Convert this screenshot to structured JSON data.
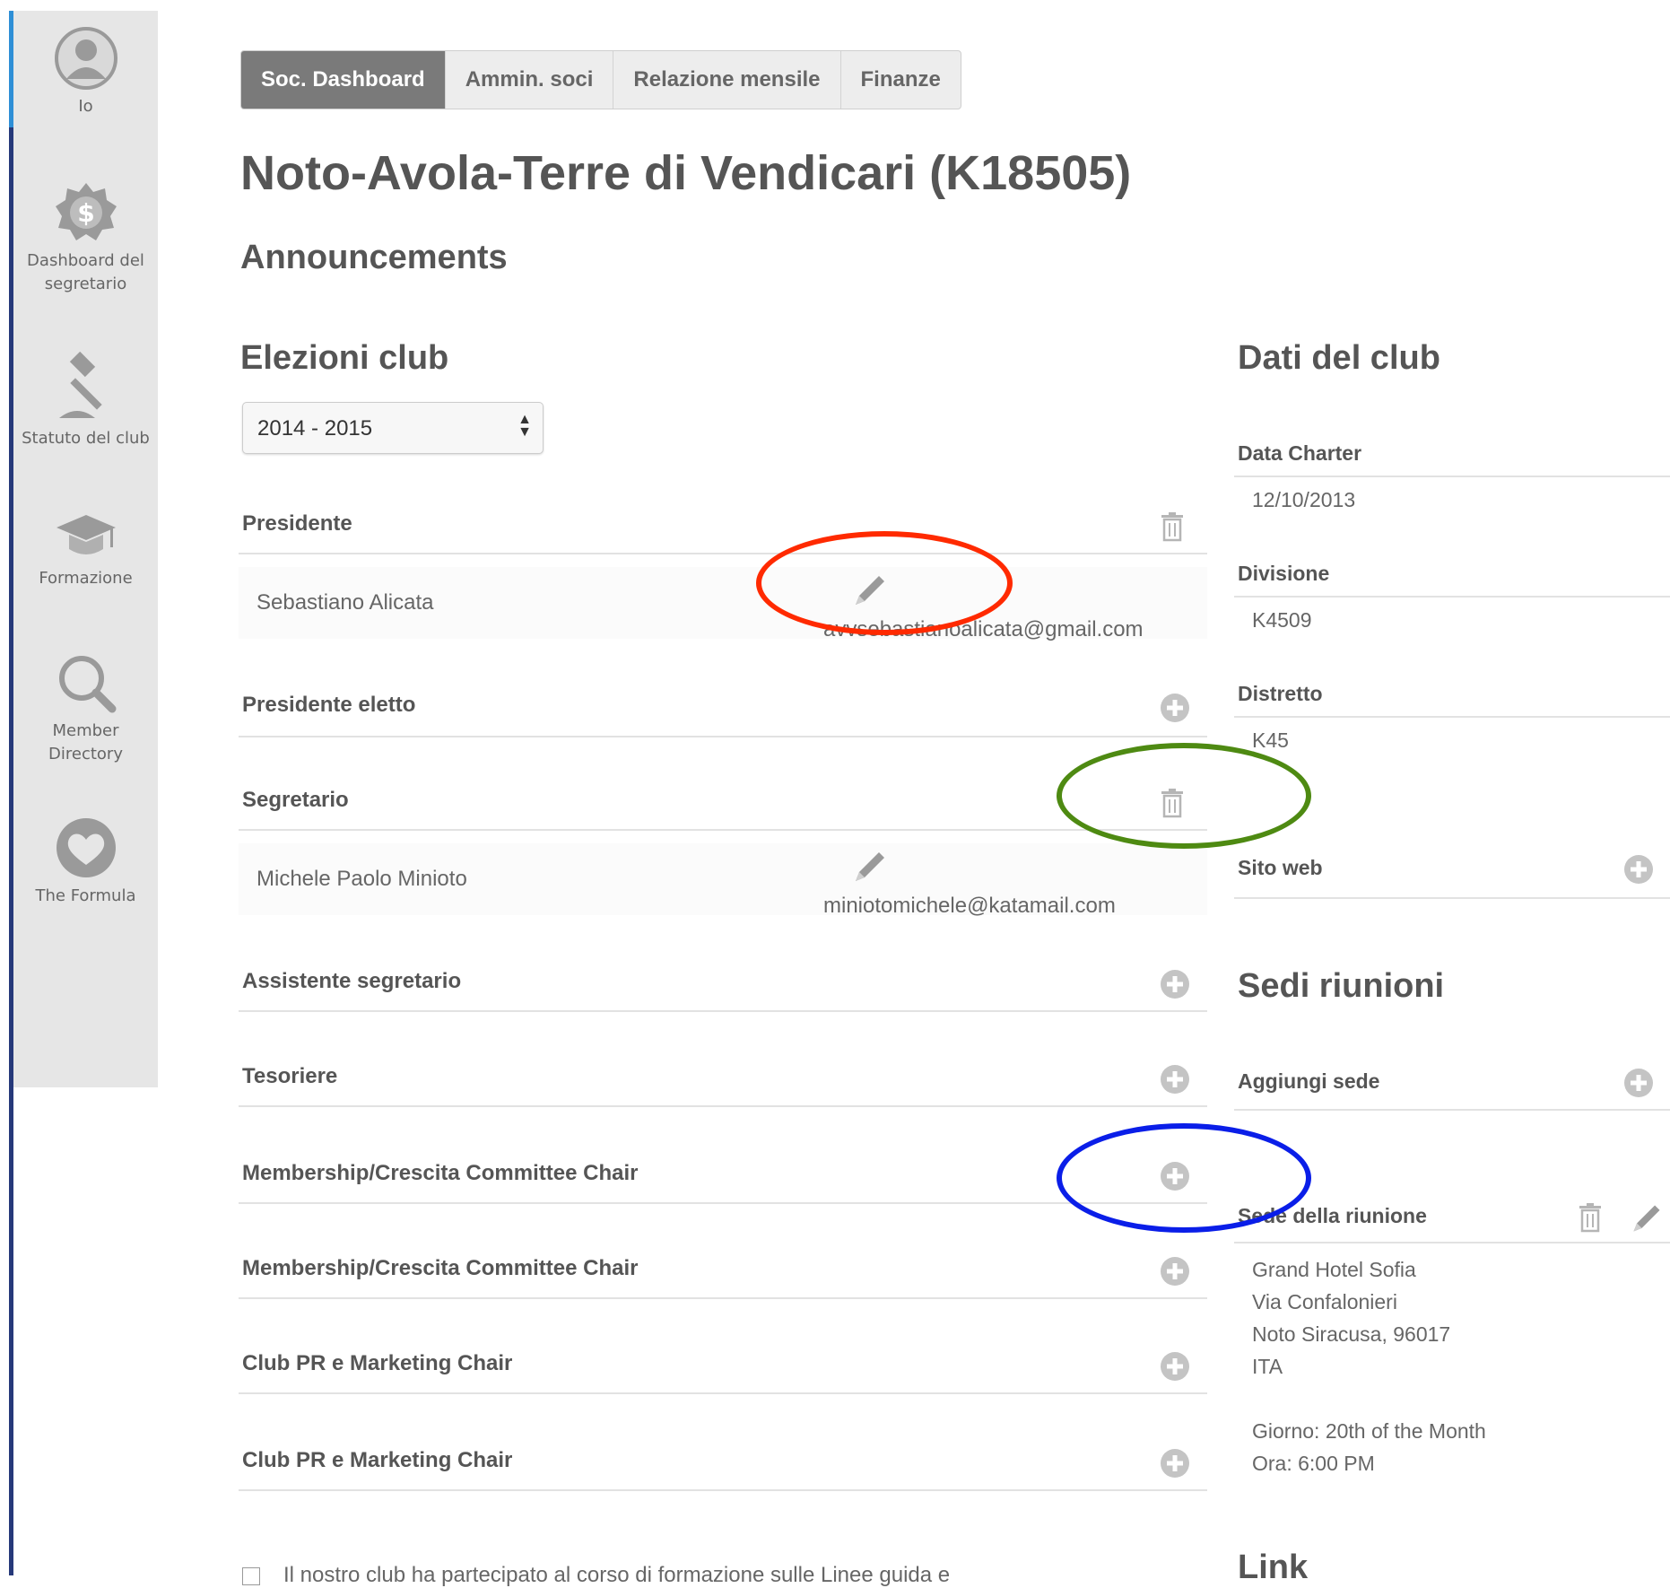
{
  "sidebar": {
    "items": [
      {
        "label": "Io",
        "icon": "user-icon"
      },
      {
        "label": "Dashboard del segretario",
        "icon": "dollar-badge-icon"
      },
      {
        "label": "Statuto del club",
        "icon": "gavel-icon"
      },
      {
        "label": "Formazione",
        "icon": "graduation-cap-icon"
      },
      {
        "label": "Member Directory",
        "icon": "search-icon"
      },
      {
        "label": "The Formula",
        "icon": "heart-icon"
      }
    ]
  },
  "tabs": [
    "Soc. Dashboard",
    "Ammin. soci",
    "Relazione mensile",
    "Finanze"
  ],
  "page_title": "Noto-Avola-Terre di Vendicari (K18505)",
  "announcements_heading": "Announcements",
  "elections": {
    "heading": "Elezioni club",
    "year_select": "2014 - 2015",
    "rows": [
      {
        "label": "Presidente",
        "action_icon": "trash-icon"
      },
      {
        "label": "Presidente eletto",
        "action_icon": "plus-circle-icon"
      },
      {
        "label": "Segretario",
        "action_icon": "trash-icon"
      },
      {
        "label": "Assistente segretario",
        "action_icon": "plus-circle-icon"
      },
      {
        "label": "Tesoriere",
        "action_icon": "plus-circle-icon"
      },
      {
        "label": "Membership/Crescita Committee Chair",
        "action_icon": "plus-circle-icon"
      },
      {
        "label": "Membership/Crescita Committee Chair",
        "action_icon": "plus-circle-icon"
      },
      {
        "label": "Club PR e Marketing Chair",
        "action_icon": "plus-circle-icon"
      },
      {
        "label": "Club PR e Marketing Chair",
        "action_icon": "plus-circle-icon"
      }
    ],
    "president": {
      "name": "Sebastiano Alicata",
      "email": "avvsebastianoalicata@gmail.com"
    },
    "secretary": {
      "name": "Michele Paolo Minioto",
      "email": "miniotomichele@katamail.com"
    },
    "checkbox_text": "Il nostro club ha partecipato al corso di formazione sulle Linee guida e"
  },
  "club_data": {
    "heading": "Dati del club",
    "fields": [
      {
        "label": "Data Charter",
        "value": "12/10/2013"
      },
      {
        "label": "Divisione",
        "value": "K4509"
      },
      {
        "label": "Distretto",
        "value": "K45"
      }
    ],
    "website_label": "Sito web"
  },
  "meeting_places": {
    "heading": "Sedi riunioni",
    "add_label": "Aggiungi sede",
    "venue_label": "Sede della riunione",
    "address": [
      "Grand Hotel Sofia",
      "Via Confalonieri",
      "Noto Siracusa, 96017",
      "ITA"
    ],
    "day": "Giorno: 20th of the Month",
    "time": "Ora: 6:00 PM"
  },
  "links_heading": "Link",
  "colors": {
    "annotation_red": "#ff2a00",
    "annotation_green": "#4e8a12",
    "annotation_blue": "#0a1ee8",
    "active_tab": "#7a7a7a",
    "sidebar_bg": "#e6e6e6"
  }
}
